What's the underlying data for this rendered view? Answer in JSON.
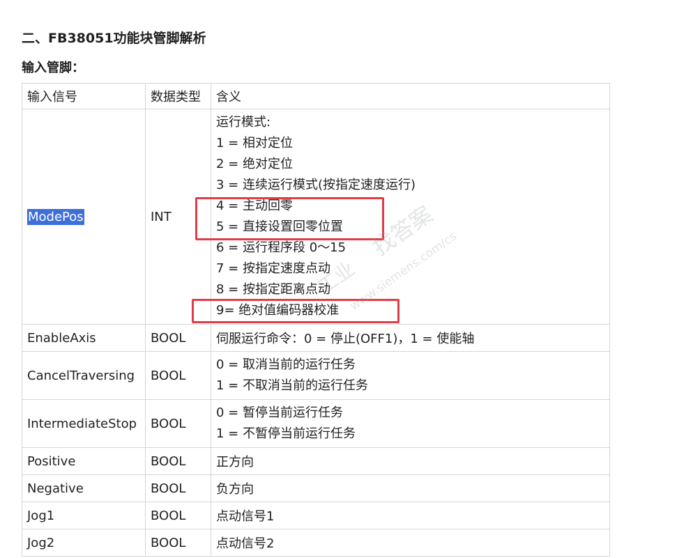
{
  "section_title": "二、FB38051功能块管脚解析",
  "subsection_title": "输入管脚：",
  "table": {
    "headers": [
      "输入信号",
      "数据类型",
      "含义"
    ],
    "rows": [
      {
        "signal": "ModePos",
        "type": "INT",
        "meaning": [
          "运行模式:",
          "1 = 相对定位",
          "2 = 绝对定位",
          "3 = 连续运行模式(按指定速度运行)",
          "4 = 主动回零",
          "5 = 直接设置回零位置",
          "6 = 运行程序段 0～15",
          "7 = 按指定速度点动",
          "8 = 按指定距离点动",
          "9= 绝对值编码器校准"
        ]
      },
      {
        "signal": "EnableAxis",
        "type": "BOOL",
        "meaning": [
          "伺服运行命令：0 = 停止(OFF1)，1 = 使能轴"
        ]
      },
      {
        "signal": "CancelTraversing",
        "type": "BOOL",
        "meaning": [
          "0 = 取消当前的运行任务",
          "1 = 不取消当前的运行任务"
        ]
      },
      {
        "signal": "IntermediateStop",
        "type": "BOOL",
        "meaning": [
          "0 = 暂停当前运行任务",
          "1 = 不暂停当前运行任务"
        ]
      },
      {
        "signal": "Positive",
        "type": "BOOL",
        "meaning": [
          "正方向"
        ]
      },
      {
        "signal": "Negative",
        "type": "BOOL",
        "meaning": [
          "负方向"
        ]
      },
      {
        "signal": "Jog1",
        "type": "BOOL",
        "meaning": [
          "点动信号1"
        ]
      },
      {
        "signal": "Jog2",
        "type": "BOOL",
        "meaning": [
          "点动信号2"
        ]
      }
    ]
  },
  "watermark": {
    "brand": "找答案",
    "url": "www.siemens.com/cs",
    "industry": "工业"
  },
  "colors": {
    "selection_highlight": "#3d6fd8",
    "annotation_box": "#e23c47"
  }
}
